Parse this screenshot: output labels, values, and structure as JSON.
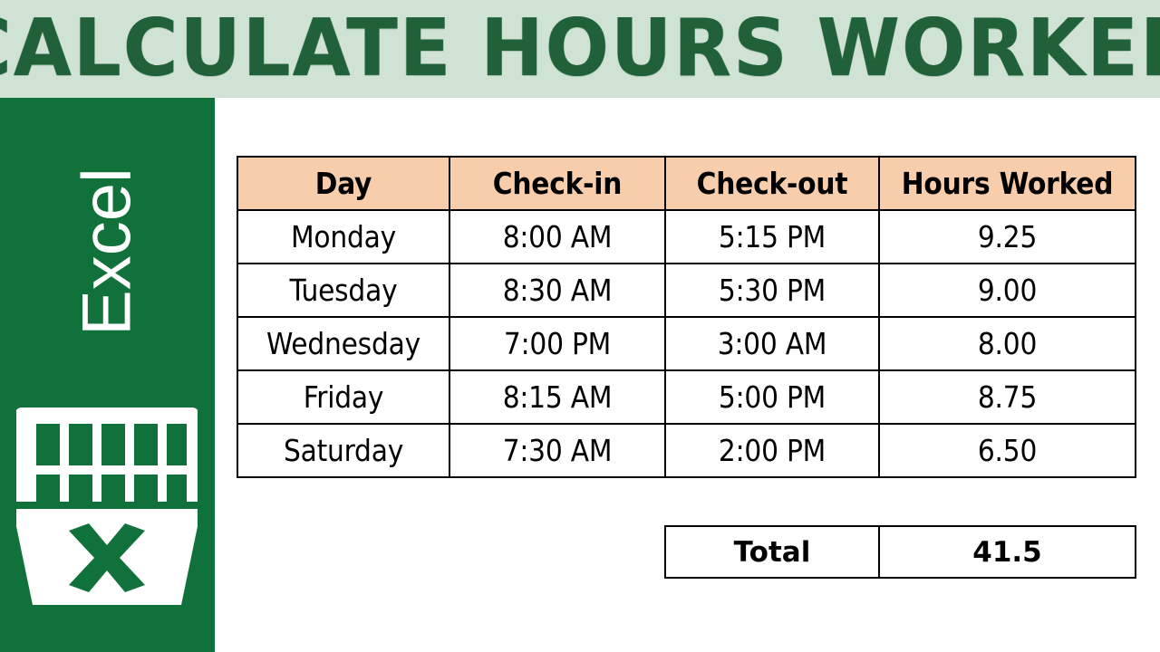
{
  "banner": {
    "title": "CALCULATE HOURS WORKED",
    "background_color": "#cfe2d3",
    "text_color": "#1a5c33"
  },
  "sidebar": {
    "wordmark": "Excel",
    "background_color": "#11713b",
    "logo_icon": "excel-spreadsheet-x-icon"
  },
  "table": {
    "headers": [
      "Day",
      "Check-in",
      "Check-out",
      "Hours Worked"
    ],
    "header_background": "#f7cdab",
    "rows": [
      {
        "day": "Monday",
        "check_in": "8:00 AM",
        "check_out": "5:15 PM",
        "hours": "9.25"
      },
      {
        "day": "Tuesday",
        "check_in": "8:30 AM",
        "check_out": "5:30 PM",
        "hours": "9.00"
      },
      {
        "day": "Wednesday",
        "check_in": "7:00 PM",
        "check_out": "3:00 AM",
        "hours": "8.00"
      },
      {
        "day": "Friday",
        "check_in": "8:15 AM",
        "check_out": "5:00 PM",
        "hours": "8.75"
      },
      {
        "day": "Saturday",
        "check_in": "7:30 AM",
        "check_out": "2:00 PM",
        "hours": "6.50"
      }
    ]
  },
  "total": {
    "label": "Total",
    "value": "41.5"
  },
  "chart_data": {
    "type": "table",
    "title": "CALCULATE HOURS WORKED",
    "columns": [
      "Day",
      "Check-in",
      "Check-out",
      "Hours Worked"
    ],
    "rows": [
      [
        "Monday",
        "8:00 AM",
        "5:15 PM",
        9.25
      ],
      [
        "Tuesday",
        "8:30 AM",
        "5:30 PM",
        9.0
      ],
      [
        "Wednesday",
        "7:00 PM",
        "3:00 AM",
        8.0
      ],
      [
        "Friday",
        "8:15 AM",
        "5:00 PM",
        8.75
      ],
      [
        "Saturday",
        "7:30 AM",
        "2:00 PM",
        6.5
      ]
    ],
    "summary": {
      "label": "Total",
      "value": 41.5
    }
  }
}
